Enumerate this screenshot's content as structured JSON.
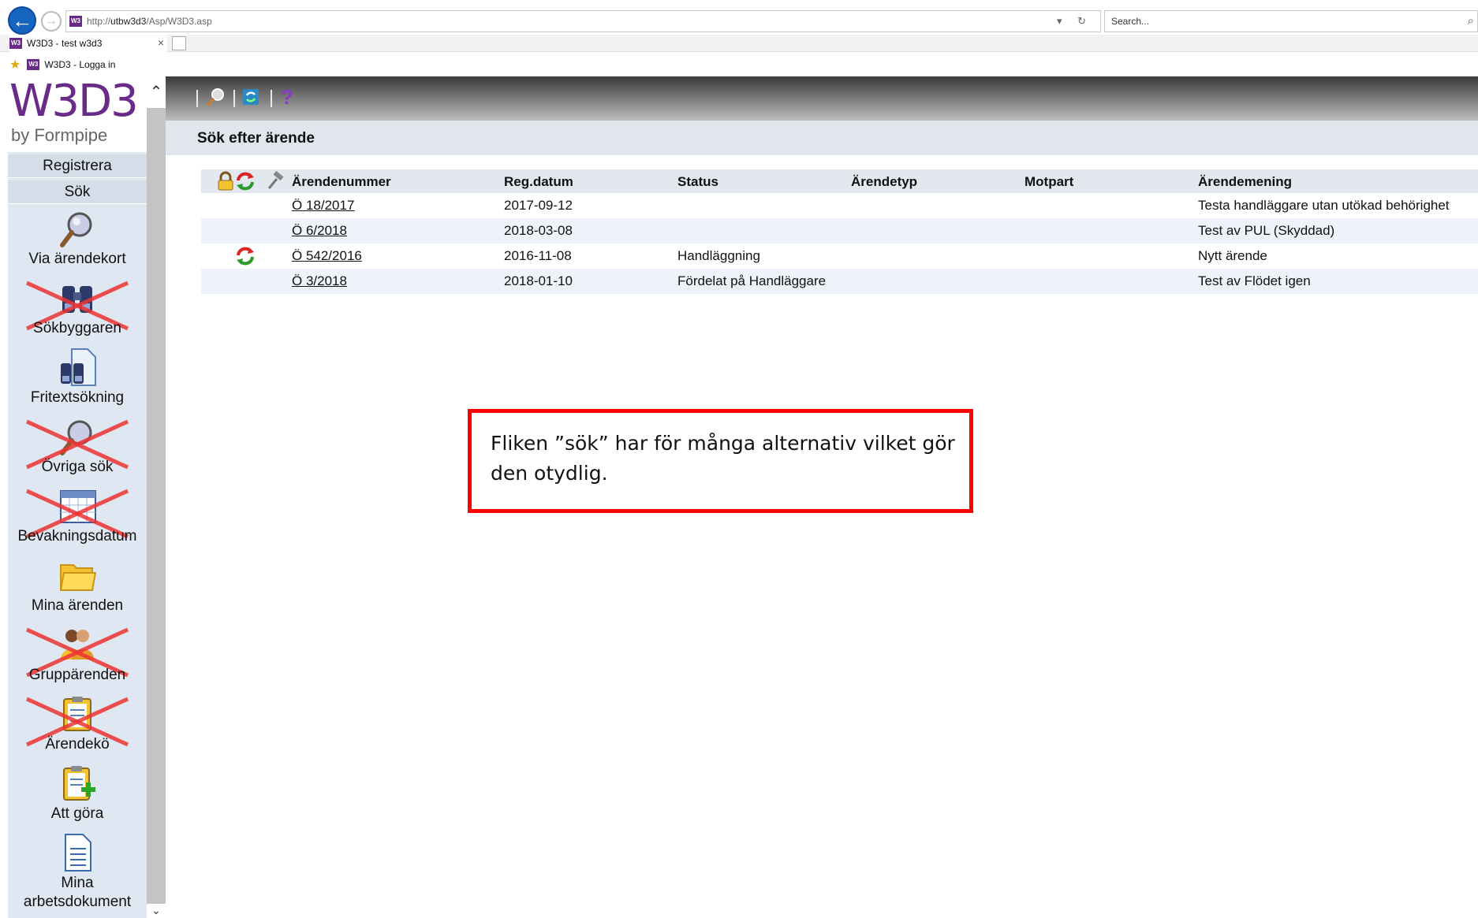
{
  "browser": {
    "url_prefix": "http://",
    "url_host": "utbw3d3",
    "url_path": "/Asp/W3D3.asp",
    "search_placeholder": "Search...",
    "tab_title": "W3D3 - test w3d3",
    "favorite_label": "W3D3 - Logga in",
    "favicon_text": "W3"
  },
  "sidebar": {
    "logo_main": "W3D3",
    "logo_sub": "by Formpipe",
    "buttons": [
      "Registrera",
      "Sök"
    ],
    "items": [
      {
        "label": "Via ärendekort",
        "icon": "magnifier-icon",
        "crossed": false
      },
      {
        "label": "Sökbyggaren",
        "icon": "binoculars-icon",
        "crossed": true
      },
      {
        "label": "Fritextsökning",
        "icon": "binoculars-document-icon",
        "crossed": false
      },
      {
        "label": "Övriga sök",
        "icon": "magnifier-icon",
        "crossed": true
      },
      {
        "label": "Bevakningsdatum",
        "icon": "calendar-icon",
        "crossed": true
      },
      {
        "label": "Mina ärenden",
        "icon": "folder-icon",
        "crossed": false
      },
      {
        "label": "Gruppärenden",
        "icon": "group-icon",
        "crossed": true
      },
      {
        "label": "Ärendekö",
        "icon": "clipboard-icon",
        "crossed": true
      },
      {
        "label": "Att göra",
        "icon": "clipboard-add-icon",
        "crossed": false
      },
      {
        "label": "Mina arbetsdokument",
        "label_line1": "Mina",
        "label_line2": "arbetsdokument",
        "icon": "document-icon",
        "crossed": false
      }
    ]
  },
  "main": {
    "heading": "Sök efter ärende",
    "columns": [
      "Ärendenummer",
      "Reg.datum",
      "Status",
      "Ärendetyp",
      "Motpart",
      "Ärendemening"
    ],
    "rows": [
      {
        "number": "Ö 18/2017",
        "date": "2017-09-12",
        "status": "",
        "type": "",
        "party": "",
        "title": "Testa handläggare utan utökad behörighet",
        "sync_icon": false
      },
      {
        "number": "Ö 6/2018",
        "date": "2018-03-08",
        "status": "",
        "type": "",
        "party": "",
        "title": "Test av PUL (Skyddad)",
        "sync_icon": false
      },
      {
        "number": "Ö 542/2016",
        "date": "2016-11-08",
        "status": "Handläggning",
        "type": "",
        "party": "",
        "title": "Nytt ärende",
        "sync_icon": true
      },
      {
        "number": "Ö 3/2018",
        "date": "2018-01-10",
        "status": "Fördelat på Handläggare",
        "type": "",
        "party": "",
        "title": "Test av Flödet igen",
        "sync_icon": false
      }
    ]
  },
  "annotation": {
    "text": "Fliken ”sök” har för många alternativ vilket gör den otydlig."
  },
  "colors": {
    "accent": "#6a2a8a",
    "annotation_border": "#ff0000",
    "back_button": "#1565c0"
  }
}
